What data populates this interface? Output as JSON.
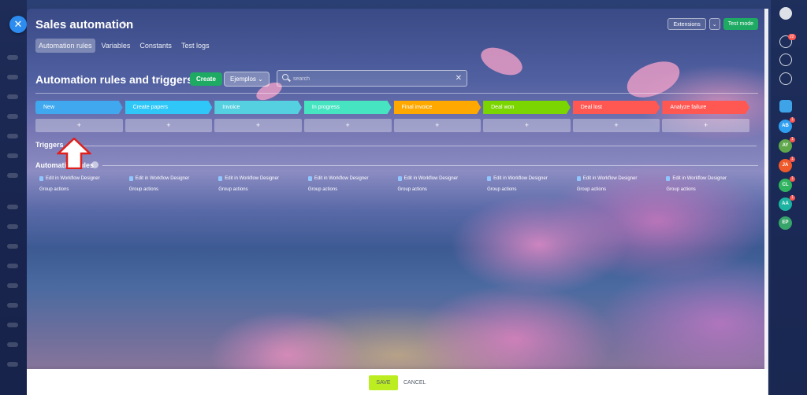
{
  "header": {
    "title": "Sales automation",
    "tabs": [
      {
        "label": "Automation rules",
        "active": true
      },
      {
        "label": "Variables",
        "active": false
      },
      {
        "label": "Constants",
        "active": false
      },
      {
        "label": "Test logs",
        "active": false
      }
    ],
    "extensions_label": "Extensions",
    "test_mode_label": "Test mode"
  },
  "toolbar": {
    "title": "Automation rules and triggers",
    "create_label": "Create",
    "ejemplos_label": "Ejemplos",
    "search_placeholder": "search"
  },
  "stages": [
    {
      "label": "New",
      "color": "#3fa8ef"
    },
    {
      "label": "Create papers",
      "color": "#2fc7f7"
    },
    {
      "label": "Invoice",
      "color": "#55d0e0"
    },
    {
      "label": "In progress",
      "color": "#47e4c2"
    },
    {
      "label": "Final invoice",
      "color": "#ffa900"
    },
    {
      "label": "Deal won",
      "color": "#7bd500"
    },
    {
      "label": "Deal lost",
      "color": "#ff5752"
    },
    {
      "label": "Analyze failure",
      "color": "#ff5752"
    }
  ],
  "add_symbol": "+",
  "sections": {
    "triggers": "Triggers",
    "automation": "Automation rules"
  },
  "columns": {
    "edit_label": "Edit in Workflow Designer",
    "group_label": "Group actions"
  },
  "footer": {
    "save_label": "SAVE",
    "cancel_label": "CANCEL"
  },
  "rail": {
    "notifications_count": "22",
    "avatars": [
      {
        "initials": "AB",
        "color": "#2f9ff0",
        "badge": "1"
      },
      {
        "initials": "AY",
        "color": "#5fa84a",
        "badge": "1"
      },
      {
        "initials": "JA",
        "color": "#f05a2a",
        "badge": "1"
      },
      {
        "initials": "CL",
        "color": "#2fb35f",
        "badge": "1"
      },
      {
        "initials": "AA",
        "color": "#1cb3a1",
        "badge": "1"
      },
      {
        "initials": "EP",
        "color": "#37a46a",
        "badge": ""
      }
    ]
  }
}
